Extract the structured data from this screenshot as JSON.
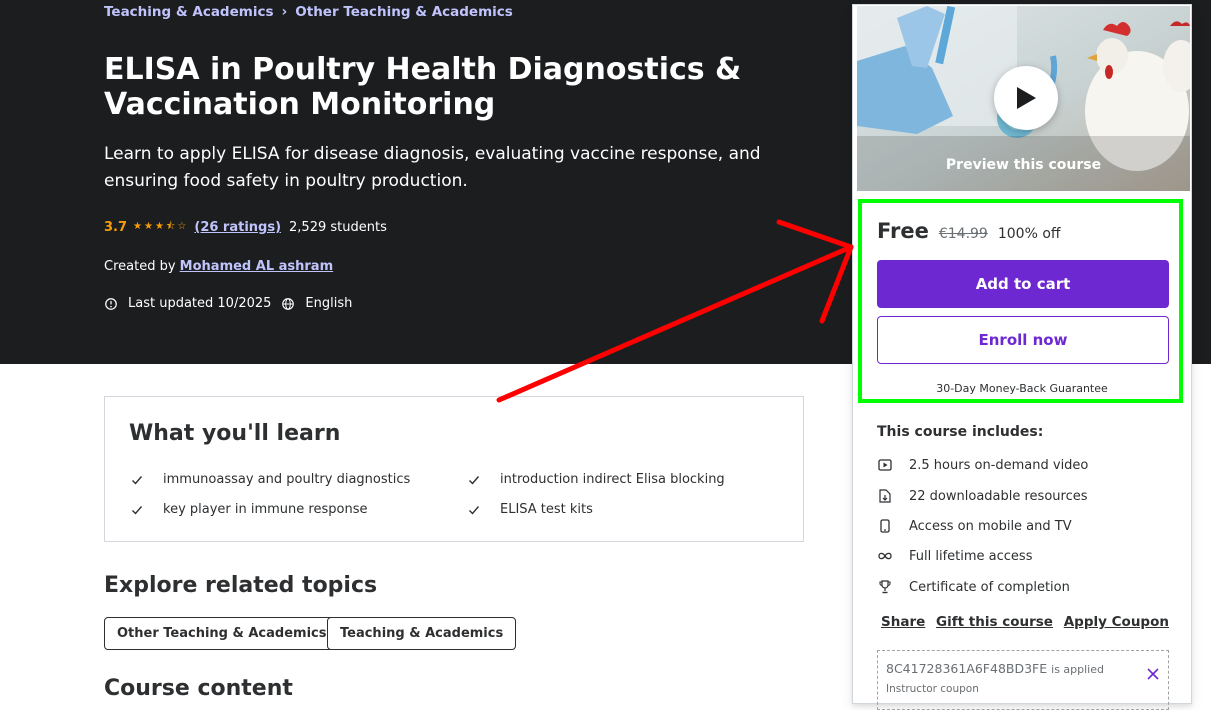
{
  "breadcrumb": {
    "items": [
      "Teaching & Academics",
      "Other Teaching & Academics"
    ],
    "separator": "›"
  },
  "course": {
    "title": "ELISA in Poultry Health Diagnostics & Vaccination Monitoring",
    "subtitle": "Learn to apply ELISA for disease diagnosis, evaluating vaccine response, and ensuring food safety in poultry production.",
    "rating": "3.7",
    "stars_value": 3.5,
    "ratings_count": "(26 ratings)",
    "students": "2,529 students",
    "created_by_label": "Created by",
    "instructor": "Mohamed AL ashram",
    "last_updated": "Last updated 10/2025",
    "language": "English"
  },
  "learn": {
    "title": "What you'll learn",
    "items": [
      "immunoassay and poultry diagnostics",
      "introduction indirect Elisa blocking",
      "key player in immune response",
      "ELISA test kits"
    ]
  },
  "explore": {
    "title": "Explore related topics",
    "topics": [
      "Other Teaching & Academics",
      "Teaching & Academics"
    ]
  },
  "next_section_title": "Course content",
  "sidebar": {
    "preview_label": "Preview this course",
    "price": "Free",
    "original_price": "€14.99",
    "discount": "100% off",
    "add_to_cart": "Add to cart",
    "enroll_now": "Enroll now",
    "guarantee": "30-Day Money-Back Guarantee",
    "includes_title": "This course includes:",
    "includes": [
      {
        "icon": "video-icon",
        "label": "2.5 hours on-demand video"
      },
      {
        "icon": "download-file-icon",
        "label": "22 downloadable resources"
      },
      {
        "icon": "mobile-icon",
        "label": "Access on mobile and TV"
      },
      {
        "icon": "infinity-icon",
        "label": "Full lifetime access"
      },
      {
        "icon": "trophy-icon",
        "label": "Certificate of completion"
      }
    ],
    "links": [
      "Share",
      "Gift this course",
      "Apply Coupon"
    ],
    "coupon_code": "8C41728361A6F48BD3FE",
    "coupon_applied": "is applied",
    "coupon_sub": "Instructor coupon"
  },
  "colors": {
    "hero_bg": "#1c1d1f",
    "accent_purple": "#6d28d2",
    "link_lavender": "#c0c4fc",
    "rating_orange": "#f69c08",
    "annotation_green": "#00ff00",
    "annotation_red": "#ff0000"
  }
}
